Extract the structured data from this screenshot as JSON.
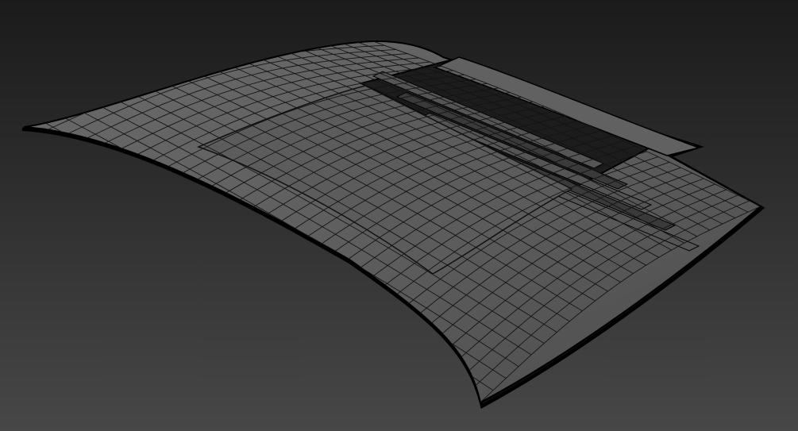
{
  "viewport": {
    "subject": "wireframe-car-roof",
    "background_top": "#1b1b1b",
    "background_bottom": "#474747",
    "surface_color": "#5a5a5a",
    "surface_highlight": "#6e6e6e",
    "wire_color": "#141414",
    "outline_color": "#000000"
  }
}
